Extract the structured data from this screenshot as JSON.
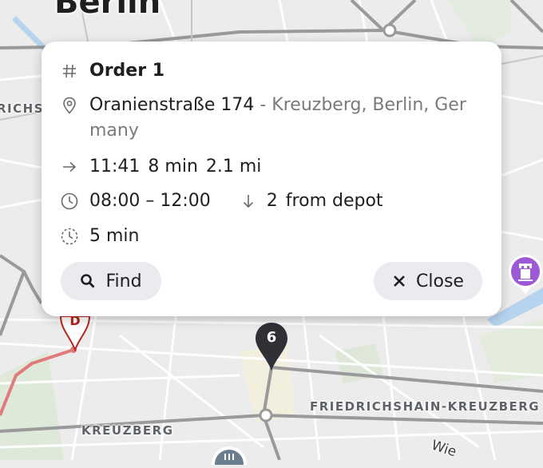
{
  "map": {
    "city": "Berlin",
    "districts": [
      "RICHS",
      "FRIEDRICHSHAIN-KREUZBERG",
      "KREUZBERG"
    ],
    "street_partial": "Wie",
    "pins": [
      {
        "label": "6",
        "color": "#2f3136"
      },
      {
        "label": "D",
        "color": "#b3261e"
      }
    ],
    "route_color": "#e07b7b"
  },
  "popup": {
    "title": "Order 1",
    "address_main": "Oranienstraße 174",
    "address_rest": "- Kreuzberg, Berlin, Ger",
    "address_wrap": "many",
    "eta_time": "11:41",
    "eta_duration": "8 min",
    "eta_distance": "2.1 mi",
    "window": "08:00 – 12:00",
    "stop_index": "2",
    "stop_from": "from depot",
    "service_time": "5 min",
    "find_label": "Find",
    "close_label": "Close",
    "icons": [
      "hash-icon",
      "location-pin-icon",
      "arrow-right-icon",
      "clock-icon",
      "arrow-down-icon",
      "timer-dashed-icon",
      "search-icon",
      "close-icon"
    ]
  }
}
